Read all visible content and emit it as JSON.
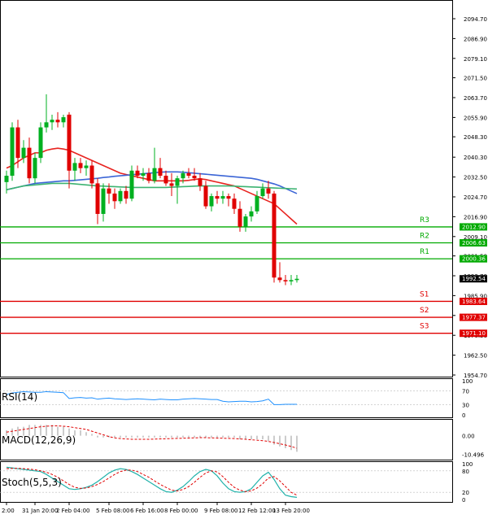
{
  "chart_data": {
    "type": "candlestick",
    "main": {
      "y_ticks": [
        "2094.70",
        "2086.90",
        "2079.10",
        "2071.50",
        "2063.70",
        "2055.90",
        "2048.30",
        "2040.30",
        "2032.50",
        "2024.70",
        "2016.90",
        "2009.10",
        "2001.50",
        "1993.70",
        "1985.90",
        "1978.10",
        "1970.30",
        "1962.50",
        "1954.70"
      ],
      "ylim": [
        1954.7,
        2094.7
      ],
      "candles": [
        {
          "o": 2030.5,
          "h": 2035.0,
          "l": 2026.0,
          "c": 2033.0
        },
        {
          "o": 2033.0,
          "h": 2054.0,
          "l": 2031.0,
          "c": 2052.0
        },
        {
          "o": 2052.0,
          "h": 2055.0,
          "l": 2036.0,
          "c": 2040.0
        },
        {
          "o": 2040.0,
          "h": 2047.0,
          "l": 2038.0,
          "c": 2044.0
        },
        {
          "o": 2044.0,
          "h": 2048.0,
          "l": 2030.0,
          "c": 2032.0
        },
        {
          "o": 2032.0,
          "h": 2042.0,
          "l": 2030.0,
          "c": 2040.0
        },
        {
          "o": 2040.0,
          "h": 2054.0,
          "l": 2038.0,
          "c": 2052.0
        },
        {
          "o": 2052.0,
          "h": 2065.0,
          "l": 2050.0,
          "c": 2054.0
        },
        {
          "o": 2054.0,
          "h": 2057.0,
          "l": 2051.0,
          "c": 2055.0
        },
        {
          "o": 2055.0,
          "h": 2058.0,
          "l": 2052.0,
          "c": 2054.0
        },
        {
          "o": 2054.0,
          "h": 2057.0,
          "l": 2052.0,
          "c": 2056.0
        },
        {
          "o": 2057.0,
          "h": 2058.0,
          "l": 2028.0,
          "c": 2035.0
        },
        {
          "o": 2035.0,
          "h": 2040.0,
          "l": 2031.0,
          "c": 2038.0
        },
        {
          "o": 2038.0,
          "h": 2040.0,
          "l": 2034.0,
          "c": 2036.0
        },
        {
          "o": 2036.0,
          "h": 2039.0,
          "l": 2033.0,
          "c": 2037.0
        },
        {
          "o": 2037.0,
          "h": 2039.0,
          "l": 2028.0,
          "c": 2030.0
        },
        {
          "o": 2030.0,
          "h": 2032.0,
          "l": 2014.0,
          "c": 2018.0
        },
        {
          "o": 2018.0,
          "h": 2030.0,
          "l": 2015.0,
          "c": 2028.0
        },
        {
          "o": 2028.0,
          "h": 2030.0,
          "l": 2022.0,
          "c": 2026.0
        },
        {
          "o": 2026.0,
          "h": 2028.0,
          "l": 2020.0,
          "c": 2023.0
        },
        {
          "o": 2023.0,
          "h": 2028.0,
          "l": 2022.0,
          "c": 2027.0
        },
        {
          "o": 2027.0,
          "h": 2029.0,
          "l": 2022.0,
          "c": 2024.0
        },
        {
          "o": 2024.0,
          "h": 2037.0,
          "l": 2023.0,
          "c": 2035.0
        },
        {
          "o": 2035.0,
          "h": 2037.0,
          "l": 2032.0,
          "c": 2033.0
        },
        {
          "o": 2033.0,
          "h": 2036.0,
          "l": 2031.0,
          "c": 2034.0
        },
        {
          "o": 2034.0,
          "h": 2036.0,
          "l": 2030.0,
          "c": 2031.0
        },
        {
          "o": 2031.0,
          "h": 2044.0,
          "l": 2030.0,
          "c": 2036.0
        },
        {
          "o": 2036.0,
          "h": 2040.0,
          "l": 2032.0,
          "c": 2033.0
        },
        {
          "o": 2033.0,
          "h": 2035.0,
          "l": 2029.0,
          "c": 2030.0
        },
        {
          "o": 2030.0,
          "h": 2034.0,
          "l": 2025.0,
          "c": 2029.0
        },
        {
          "o": 2029.0,
          "h": 2033.0,
          "l": 2022.0,
          "c": 2032.0
        },
        {
          "o": 2032.0,
          "h": 2035.0,
          "l": 2030.0,
          "c": 2034.0
        },
        {
          "o": 2034.0,
          "h": 2036.0,
          "l": 2032.0,
          "c": 2033.0
        },
        {
          "o": 2033.0,
          "h": 2036.0,
          "l": 2031.0,
          "c": 2032.0
        },
        {
          "o": 2032.0,
          "h": 2034.0,
          "l": 2027.0,
          "c": 2029.0
        },
        {
          "o": 2029.0,
          "h": 2031.0,
          "l": 2020.0,
          "c": 2021.0
        },
        {
          "o": 2021.0,
          "h": 2026.0,
          "l": 2019.0,
          "c": 2025.0
        },
        {
          "o": 2025.0,
          "h": 2027.0,
          "l": 2022.0,
          "c": 2024.0
        },
        {
          "o": 2024.0,
          "h": 2027.0,
          "l": 2022.0,
          "c": 2025.0
        },
        {
          "o": 2025.0,
          "h": 2026.0,
          "l": 2021.0,
          "c": 2024.0
        },
        {
          "o": 2024.0,
          "h": 2026.0,
          "l": 2018.0,
          "c": 2020.0
        },
        {
          "o": 2020.0,
          "h": 2023.0,
          "l": 2011.0,
          "c": 2013.0
        },
        {
          "o": 2013.0,
          "h": 2018.0,
          "l": 2011.0,
          "c": 2017.0
        },
        {
          "o": 2017.0,
          "h": 2021.0,
          "l": 2015.0,
          "c": 2019.0
        },
        {
          "o": 2019.0,
          "h": 2027.0,
          "l": 2018.0,
          "c": 2025.0
        },
        {
          "o": 2025.0,
          "h": 2030.0,
          "l": 2024.0,
          "c": 2028.0
        },
        {
          "o": 2028.0,
          "h": 2031.0,
          "l": 2024.0,
          "c": 2026.0
        },
        {
          "o": 2026.0,
          "h": 2027.0,
          "l": 1991.0,
          "c": 1993.0
        },
        {
          "o": 1993.0,
          "h": 1999.0,
          "l": 1991.0,
          "c": 1992.0
        },
        {
          "o": 1992.0,
          "h": 1994.0,
          "l": 1990.0,
          "c": 1991.5
        },
        {
          "o": 1991.5,
          "h": 1994.0,
          "l": 1990.0,
          "c": 1992.0
        },
        {
          "o": 1992.0,
          "h": 1994.0,
          "l": 1991.0,
          "c": 1992.5
        }
      ],
      "moving_averages": [
        {
          "color": "#e8231f",
          "values": [
            2036.0,
            2037.0,
            2038.5,
            2040.0,
            2041.0,
            2042.0,
            2042.0,
            2043.0,
            2043.5,
            2043.8,
            2043.5,
            2043.0,
            2042.0,
            2041.0,
            2040.0,
            2039.0,
            2038.0,
            2037.0,
            2036.0,
            2035.0,
            2034.0,
            2033.5,
            2033.0,
            2032.5,
            2032.0,
            2031.5,
            2031.0,
            2031.0,
            2031.0,
            2031.0,
            2031.0,
            2031.0,
            2031.2,
            2031.5,
            2031.8,
            2031.5,
            2031.0,
            2030.5,
            2030.0,
            2029.5,
            2029.0,
            2028.0,
            2027.0,
            2026.0,
            2025.0,
            2024.0,
            2023.0,
            2022.0,
            2020.0,
            2018.0,
            2016.0,
            2014.0
          ]
        },
        {
          "color": "#3b65d6",
          "values": [
            2027.5,
            2028.0,
            2028.5,
            2029.0,
            2029.5,
            2030.0,
            2030.2,
            2030.4,
            2030.6,
            2030.8,
            2031.0,
            2031.0,
            2031.2,
            2031.4,
            2031.6,
            2031.8,
            2032.0,
            2032.3,
            2032.5,
            2032.8,
            2033.0,
            2033.2,
            2033.4,
            2033.6,
            2033.8,
            2034.0,
            2034.2,
            2034.4,
            2034.5,
            2034.5,
            2034.5,
            2034.4,
            2034.2,
            2034.0,
            2033.8,
            2033.6,
            2033.4,
            2033.2,
            2033.0,
            2032.8,
            2032.6,
            2032.4,
            2032.2,
            2032.0,
            2031.6,
            2031.0,
            2030.4,
            2029.8,
            2029.0,
            2028.0,
            2027.0,
            2026.0
          ]
        },
        {
          "color": "#3cb371",
          "values": [
            2027.5,
            2028.0,
            2028.5,
            2029.0,
            2029.2,
            2029.4,
            2029.6,
            2029.8,
            2030.0,
            2030.0,
            2030.0,
            2030.0,
            2029.8,
            2029.6,
            2029.4,
            2029.2,
            2029.0,
            2028.9,
            2028.8,
            2028.7,
            2028.6,
            2028.5,
            2028.4,
            2028.4,
            2028.4,
            2028.4,
            2028.4,
            2028.4,
            2028.4,
            2028.5,
            2028.6,
            2028.7,
            2028.8,
            2028.9,
            2029.0,
            2029.0,
            2029.0,
            2029.0,
            2029.0,
            2029.0,
            2028.9,
            2028.8,
            2028.7,
            2028.6,
            2028.5,
            2028.4,
            2028.3,
            2028.2,
            2028.1,
            2028.0,
            2027.9,
            2027.8
          ]
        }
      ],
      "levels": [
        {
          "label": "R3",
          "value": 2012.9,
          "tag": "2012.90",
          "color": "#00aa00"
        },
        {
          "label": "R2",
          "value": 2006.63,
          "tag": "2006.63",
          "color": "#00aa00"
        },
        {
          "label": "R1",
          "value": 2000.36,
          "tag": "2000.36",
          "color": "#00aa00"
        },
        {
          "label": "S1",
          "value": 1983.64,
          "tag": "1983.64",
          "color": "#e00000"
        },
        {
          "label": "S2",
          "value": 1977.37,
          "tag": "1977.37",
          "color": "#e00000"
        },
        {
          "label": "S3",
          "value": 1971.1,
          "tag": "1971.10",
          "color": "#e00000"
        }
      ],
      "current_price": "1992.54"
    },
    "rsi": {
      "label": "RSI(14)",
      "y_ticks": [
        "100",
        "70",
        "30",
        "0"
      ],
      "ylim": [
        0,
        100
      ],
      "values": [
        60,
        64,
        66,
        68,
        67,
        66,
        66,
        68,
        67,
        66,
        65,
        48,
        50,
        51,
        49,
        50,
        46,
        48,
        49,
        47,
        46,
        45,
        46,
        47,
        46,
        45,
        44,
        46,
        45,
        44,
        44,
        46,
        47,
        48,
        47,
        46,
        45,
        45,
        40,
        38,
        39,
        40,
        40,
        38,
        39,
        41,
        46,
        30,
        30,
        31,
        31,
        31
      ]
    },
    "macd": {
      "label": "MACD(12,26,9)",
      "y_ticks": [
        "0.00",
        "-10.496"
      ],
      "ylim": [
        -12,
        8
      ],
      "histogram": [
        3,
        4,
        5,
        5,
        6,
        6,
        6,
        6,
        6,
        5,
        5,
        4,
        3,
        3,
        2,
        1,
        -1,
        -1,
        -1,
        -1,
        -1,
        -1,
        -1,
        -1,
        -1,
        -1,
        -1,
        -1,
        -1,
        -1,
        -1,
        -1,
        -1,
        -1,
        -1,
        -1,
        -1,
        -1,
        -1,
        -1,
        -1,
        -2,
        -2,
        -2,
        -2,
        -2,
        -3,
        -5,
        -6,
        -7,
        -8,
        -9
      ],
      "signal": [
        2,
        2.5,
        3,
        3.5,
        4,
        4.5,
        5,
        5.3,
        5.5,
        5.5,
        5.3,
        5,
        4.5,
        4,
        3.5,
        2.5,
        1.5,
        0.5,
        -0.5,
        -1.2,
        -1.6,
        -1.8,
        -2,
        -2,
        -2,
        -2,
        -1.9,
        -1.8,
        -1.7,
        -1.6,
        -1.5,
        -1.4,
        -1.3,
        -1.2,
        -1.1,
        -1.1,
        -1.2,
        -1.3,
        -1.4,
        -1.5,
        -1.6,
        -1.8,
        -2,
        -2.3,
        -2.5,
        -2.8,
        -3.2,
        -3.8,
        -4.5,
        -5.2,
        -6,
        -7
      ]
    },
    "stoch": {
      "label": "Stoch(5,5,3)",
      "y_ticks": [
        "100",
        "80",
        "20",
        "0"
      ],
      "ylim": [
        0,
        100
      ],
      "k": [
        90,
        88,
        86,
        84,
        82,
        80,
        78,
        70,
        60,
        50,
        40,
        30,
        28,
        30,
        34,
        40,
        50,
        62,
        74,
        82,
        86,
        84,
        78,
        70,
        60,
        50,
        40,
        30,
        22,
        20,
        26,
        36,
        50,
        66,
        78,
        84,
        80,
        66,
        46,
        30,
        22,
        20,
        22,
        30,
        48,
        66,
        76,
        56,
        30,
        12,
        8,
        6
      ],
      "d": [
        86,
        87,
        87,
        86,
        85,
        83,
        80,
        76,
        70,
        62,
        52,
        42,
        34,
        31,
        32,
        36,
        42,
        50,
        60,
        70,
        78,
        82,
        82,
        78,
        70,
        62,
        52,
        42,
        34,
        26,
        24,
        28,
        36,
        48,
        62,
        74,
        80,
        77,
        64,
        48,
        34,
        26,
        22,
        24,
        32,
        44,
        60,
        64,
        52,
        36,
        20,
        12
      ]
    },
    "x_labels": [
      {
        "text": "2:00",
        "i": 0
      },
      {
        "text": "31 Jan 20:00",
        "i": 5
      },
      {
        "text": "2 Feb 04:00",
        "i": 11
      },
      {
        "text": "5 Feb 08:00",
        "i": 18
      },
      {
        "text": "6 Feb 16:00",
        "i": 24
      },
      {
        "text": "8 Feb 00:00",
        "i": 30
      },
      {
        "text": "9 Feb 08:00",
        "i": 37
      },
      {
        "text": "12 Feb 12:00",
        "i": 43
      },
      {
        "text": "13 Feb 20:00",
        "i": 49
      }
    ]
  }
}
